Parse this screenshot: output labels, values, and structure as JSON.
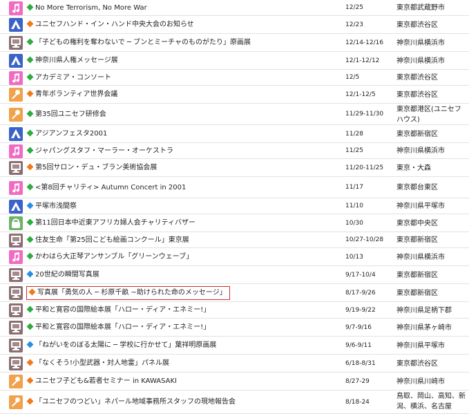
{
  "events": [
    {
      "icon": "music-note-icon",
      "bullet": "green",
      "title": "No More Terrorism, No More War",
      "date": "12/25",
      "place": "東京都武蔵野市"
    },
    {
      "icon": "tent-icon",
      "bullet": "orange",
      "title": "ユニセフハンド・イン・ハンド中央大会のお知らせ",
      "date": "12/23",
      "place": "東京都渋谷区"
    },
    {
      "icon": "screen-icon",
      "bullet": "green",
      "title": "「子どもの権利を奪わないで ─ ブンとミーチャのものがたり」原画展",
      "date": "12/14-12/16",
      "place": "神奈川県横浜市"
    },
    {
      "icon": "tent-icon",
      "bullet": "green",
      "title": "神奈川県人権メッセージ展",
      "date": "12/1-12/12",
      "place": "神奈川県横浜市"
    },
    {
      "icon": "music-note-icon",
      "bullet": "green",
      "title": "アカデミア・コンソート",
      "date": "12/5",
      "place": "東京都渋谷区"
    },
    {
      "icon": "microphone-icon",
      "bullet": "orange",
      "title": "青年ボランティア世界会議",
      "date": "12/1-12/5",
      "place": "東京都渋谷区"
    },
    {
      "icon": "microphone-icon",
      "bullet": "green",
      "title": "第35回ユニセフ研修会",
      "date": "11/29-11/30",
      "place": "東京都港区(ユニセフハウス)"
    },
    {
      "icon": "tent-icon",
      "bullet": "green",
      "title": "アジアンフェスタ2001",
      "date": "11/28",
      "place": "東京都新宿区"
    },
    {
      "icon": "music-note-icon",
      "bullet": "green",
      "title": "ジャパングスタフ・マーラー・オーケストラ",
      "date": "11/25",
      "place": "神奈川県横浜市"
    },
    {
      "icon": "screen-icon",
      "bullet": "orange",
      "title": "第5回サロン・デュ・ブラン美術協会展",
      "date": "11/20-11/25",
      "place": "東京・大森"
    },
    {
      "icon": "music-note-icon",
      "bullet": "green",
      "title": "<第8回チャリティ> Autumn Concert in 2001",
      "date": "11/17",
      "place": "東京都台東区"
    },
    {
      "icon": "tent-icon",
      "bullet": "blue",
      "title": "平塚市浅間祭",
      "date": "11/10",
      "place": "神奈川県平塚市"
    },
    {
      "icon": "bag-icon",
      "bullet": "green",
      "title": "第11回日本中近東アフリカ婦人会チャリティバザー",
      "date": "10/30",
      "place": "東京都中央区"
    },
    {
      "icon": "screen-icon",
      "bullet": "green",
      "title": "住友生命「第25回こども絵画コンクール」東京展",
      "date": "10/27-10/28",
      "place": "東京都新宿区"
    },
    {
      "icon": "music-note-icon",
      "bullet": "green",
      "title": "かわはら大正琴アンサンブル「グリーンウェーブ」",
      "date": "10/13",
      "place": "神奈川県横浜市"
    },
    {
      "icon": "screen-icon",
      "bullet": "blue",
      "title": "20世紀の瞬間写真展",
      "date": "9/17-10/4",
      "place": "東京都新宿区"
    },
    {
      "icon": "screen-icon",
      "bullet": "orange",
      "title": "写真展「勇気の人 ─ 杉原千畝 ~助けられた命のメッセージ」",
      "date": "8/17-9/26",
      "place": "東京都新宿区"
    },
    {
      "icon": "screen-icon",
      "bullet": "green",
      "title": "平和と寛容の国際絵本展「ハロー・ディア・エネミー!」",
      "date": "9/19-9/22",
      "place": "神奈川県足柄下郡"
    },
    {
      "icon": "screen-icon",
      "bullet": "green",
      "title": "平和と寛容の国際絵本展「ハロー・ディア・エネミー!」",
      "date": "9/7-9/16",
      "place": "神奈川県茅ヶ崎市"
    },
    {
      "icon": "screen-icon",
      "bullet": "blue",
      "title": "「ねがいをのぼる太陽に ─ 学校に行かせて」葉祥明原画展",
      "date": "9/6-9/11",
      "place": "神奈川県平塚市"
    },
    {
      "icon": "screen-icon",
      "bullet": "orange",
      "title": "「なくそう!小型武器・対人地雷」パネル展",
      "date": "6/18-8/31",
      "place": "東京都渋谷区"
    },
    {
      "icon": "microphone-icon",
      "bullet": "orange",
      "title": "ユニセフ子ども&若者セミナー in KAWASAKI",
      "date": "8/27-29",
      "place": "神奈川県川崎市"
    },
    {
      "icon": "microphone-icon",
      "bullet": "orange",
      "title": "「ユニセフのつどい」ネパール地域事務所スタッフの現地報告会",
      "date": "8/18-24",
      "place": "鳥取、岡山、高知、新潟、横浜、名古屋"
    }
  ]
}
